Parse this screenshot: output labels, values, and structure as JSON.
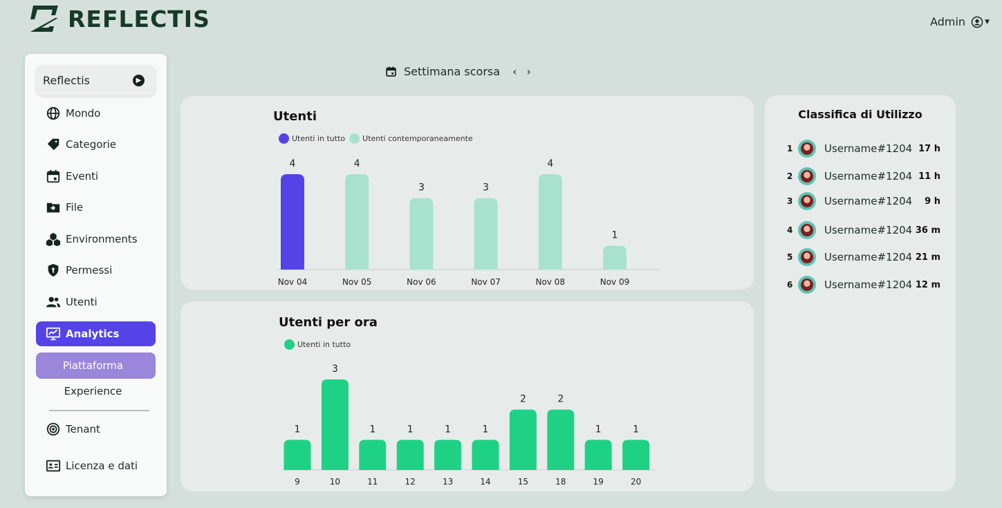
{
  "brand": {
    "name": "REFLECTIS"
  },
  "header": {
    "user_label": "Admin"
  },
  "sidebar": {
    "tenant": "Reflectis",
    "items": [
      {
        "label": "Mondo",
        "icon": "globe-icon"
      },
      {
        "label": "Categorie",
        "icon": "tag-icon"
      },
      {
        "label": "Eventi",
        "icon": "calendar-icon"
      },
      {
        "label": "File",
        "icon": "folder-icon"
      },
      {
        "label": "Environments",
        "icon": "cubes-icon"
      },
      {
        "label": "Permessi",
        "icon": "shield-icon"
      },
      {
        "label": "Utenti",
        "icon": "users-icon"
      },
      {
        "label": "Analytics",
        "icon": "chart-monitor-icon"
      }
    ],
    "analytics_sub": [
      "Piattaforma",
      "Experience"
    ],
    "bottom_items": [
      {
        "label": "Tenant",
        "icon": "target-icon"
      },
      {
        "label": "Licenza e dati",
        "icon": "license-icon"
      }
    ]
  },
  "date_range": {
    "label": "Settimana scorsa"
  },
  "colors": {
    "accent": "#5543e8",
    "mint": "#a8e2cf",
    "green": "#1ed184",
    "sub_active": "#9a86da"
  },
  "chart_data": [
    {
      "type": "bar",
      "title": "Utenti",
      "legend": [
        "Utenti in tutto",
        "Utenti contemporaneamente"
      ],
      "categories": [
        "Nov 04",
        "Nov 05",
        "Nov 06",
        "Nov 07",
        "Nov 08",
        "Nov 09"
      ],
      "values": [
        4,
        4,
        3,
        3,
        4,
        1
      ],
      "highlight_index": 0,
      "ylim": [
        0,
        4
      ]
    },
    {
      "type": "bar",
      "title": "Utenti per ora",
      "legend": [
        "Utenti in tutto"
      ],
      "categories": [
        "9",
        "10",
        "11",
        "12",
        "13",
        "14",
        "15",
        "18",
        "19",
        "20"
      ],
      "values": [
        1,
        3,
        1,
        1,
        1,
        1,
        2,
        2,
        1,
        1
      ],
      "ylim": [
        0,
        3
      ]
    }
  ],
  "ranking": {
    "title": "Classifica di Utilizzo",
    "rows": [
      {
        "rank": "1",
        "name": "Username#1204",
        "time": "17 h"
      },
      {
        "rank": "2",
        "name": "Username#1204",
        "time": "11 h"
      },
      {
        "rank": "3",
        "name": "Username#1204",
        "time": "9 h"
      },
      {
        "rank": "4",
        "name": "Username#1204",
        "time": "36 m"
      },
      {
        "rank": "5",
        "name": "Username#1204",
        "time": "21 m"
      },
      {
        "rank": "6",
        "name": "Username#1204",
        "time": "12 m"
      }
    ]
  }
}
